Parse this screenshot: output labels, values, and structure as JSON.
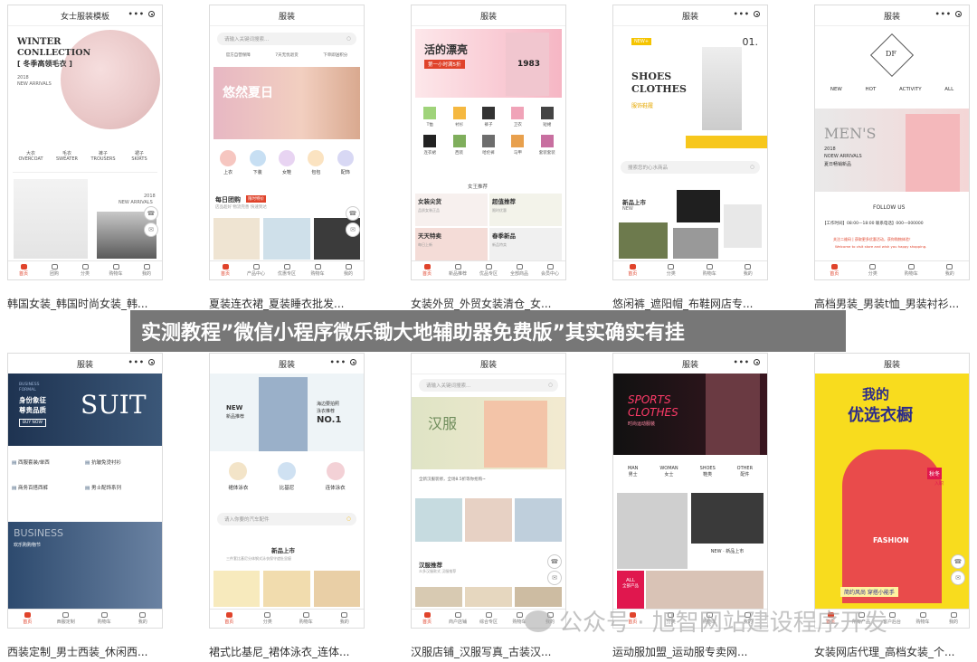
{
  "cards": [
    {
      "title": "女士服装模板",
      "caption": "韩国女装_韩国时尚女装_韩..."
    },
    {
      "title": "服装",
      "caption": "夏装连衣裙_夏装睡衣批发..."
    },
    {
      "title": "服装",
      "caption": "女装外贸_外贸女装清仓_女..."
    },
    {
      "title": "服装",
      "caption": "悠闲裤_遮阳帽_布鞋网店专..."
    },
    {
      "title": "服装",
      "caption": "高档男装_男装t恤_男装衬衫..."
    },
    {
      "title": "服装",
      "caption": "西装定制_男士西装_休闲西..."
    },
    {
      "title": "服装",
      "caption": "裙式比基尼_裙体泳衣_连体..."
    },
    {
      "title": "服装",
      "caption": "汉服店铺_汉服写真_古装汉..."
    },
    {
      "title": "服装",
      "caption": "运动服加盟_运动服专卖网..."
    },
    {
      "title": "服装",
      "caption": "女装网店代理_高档女装_个..."
    }
  ],
  "banner_text": "实测教程”微信小程序微乐锄大地辅助器免费版”其实确实有挂",
  "watermark_text": "公众号 · 旭智网站建设程序开发",
  "c1": {
    "h1": "WINTER",
    "h2": "CONLLECTION",
    "h3": "[ 冬季高领毛衣 ]",
    "year": "2018",
    "arr": "NEW ARRIVALS",
    "cats": [
      {
        "zh": "大衣",
        "en": "OVERCOAT"
      },
      {
        "zh": "毛衣",
        "en": "SWEATER"
      },
      {
        "zh": "裤子",
        "en": "TROUSERS"
      },
      {
        "zh": "裙子",
        "en": "SKIRTS"
      }
    ],
    "year2": "2018",
    "arr2": "NEW ARRIVALS",
    "tabs": [
      "首页",
      "团购",
      "分类",
      "购物车",
      "我的"
    ]
  },
  "c2": {
    "search": "请输入关键词搜索...",
    "badges": [
      "官方自营保障",
      "7天无忧退货",
      "下单即送积分"
    ],
    "bannerText": "悠然夏日",
    "icons": [
      "上衣",
      "下装",
      "女鞋",
      "包包",
      "配饰"
    ],
    "group": "每日团购",
    "groupTag": "限时特价",
    "groupSub": "店品超好 物流完善 快速到达",
    "tabs": [
      "首页",
      "产品中心",
      "优惠专区",
      "购物车",
      "我的"
    ]
  },
  "c3": {
    "banner1": "活的漂亮",
    "banner2": "第一小时满5折",
    "shirt": "1983",
    "cats": [
      "T恤",
      "衬衫",
      "裤子",
      "卫衣",
      "短裙",
      "连衣裙",
      "西装",
      "哈伦裤",
      "马甲",
      "套装套装"
    ],
    "sectionTitle": "女王推荐",
    "items": [
      {
        "t": "女装尖货",
        "s": "品质女装正品"
      },
      {
        "t": "超值推荐",
        "s": "限时优惠"
      },
      {
        "t": "天天特卖",
        "s": "每日上新"
      },
      {
        "t": "春季新品",
        "s": "新品特卖"
      }
    ],
    "tabs": [
      "首页",
      "新品推荐",
      "优品专区",
      "全部商品",
      "会员中心"
    ]
  },
  "c4": {
    "tag": "NEW+",
    "num": "01.",
    "h1": "SHOES",
    "h2": "CLOTHES",
    "sub": "服饰鞋履",
    "search": "搜索您的心水商品",
    "newTitle": "新品上市",
    "newEn": "NEW",
    "tabs": [
      "首页",
      "分类",
      "购物车",
      "我的"
    ]
  },
  "c5": {
    "logo": "DF",
    "nav": [
      "NEW",
      "HOT",
      "ACTIVITY",
      "ALL"
    ],
    "h1": "MEN'S",
    "year": "2018",
    "arr": "NOEW ARRIVALS",
    "sub": "夏日畅销新品",
    "follow": "FOLLOW US",
    "hours": "【工作时间】08:00—18:00  联系电话】000—000000",
    "notice": "关注二维码 | 获取更多优惠活动，获你购物体验！",
    "welcome": "Welcome to visit store and wish you happy shopping.",
    "tabs": [
      "首页",
      "分类",
      "购物车",
      "我的"
    ]
  },
  "c6": {
    "b1": "BUSINESS",
    "b2": "FORMAL",
    "zh1": "身份象征",
    "zh2": "尊贵品质",
    "btn": "BUY NOW",
    "big": "SUIT",
    "menu": [
      "西服套装/单西",
      "抗皱免烫衬衫",
      "商务百搭西裤",
      "男士配饰系列"
    ],
    "business": "BUSINESS",
    "sale": "欢乐购购物节",
    "tabs": [
      "首页",
      "西服定制",
      "购物车",
      "我的"
    ]
  },
  "c7": {
    "new": "NEW",
    "sub": "新品推荐",
    "no": "NO.1",
    "hot": "海边要拍照",
    "ch": "泳衣推荐",
    "cats": [
      "裙体泳衣",
      "比基尼",
      "连体泳衣"
    ],
    "search": "请入你要的汽车配件",
    "newTitle": "新品上市",
    "newSub": "三件套比基尼分体钢式泳衣保守遮肚显瘦",
    "tabs": [
      "首页",
      "分类",
      "购物车",
      "我的"
    ]
  },
  "c8": {
    "search": "请输入关键词搜索...",
    "h": "汉服",
    "notice": "全新汉服装修，全场8.5折等你抢购~",
    "rec": "汉服推荐",
    "recSub": "众多汉服款式 汉服推荐",
    "tabs": [
      "首页",
      "商户店铺",
      "综合专区",
      "购物车",
      "我的"
    ]
  },
  "c9": {
    "h1": "SPORTS",
    "h2": "CLOTHES",
    "sub": "时尚运动服装",
    "cats": [
      {
        "en": "MAN",
        "zh": "男士"
      },
      {
        "en": "WOMAN",
        "zh": "女士"
      },
      {
        "en": "SHOES",
        "zh": "鞋类"
      },
      {
        "en": "OTHER",
        "zh": "配件"
      }
    ],
    "newTag": "NEW · 新品上市",
    "all": "ALL",
    "allSub": "全部产品",
    "tabs": [
      "首页",
      "分类",
      "购物车",
      "我的"
    ]
  },
  "c10": {
    "h1": "我的",
    "h2": "优选衣橱",
    "tag1": "秋冬",
    "tag2": "入职",
    "shirt": "FASHION",
    "footer": "简约风尚 穿搭小能手",
    "tabs": [
      "首页",
      "所有产品",
      "客户后台",
      "购物车",
      "我的"
    ]
  }
}
